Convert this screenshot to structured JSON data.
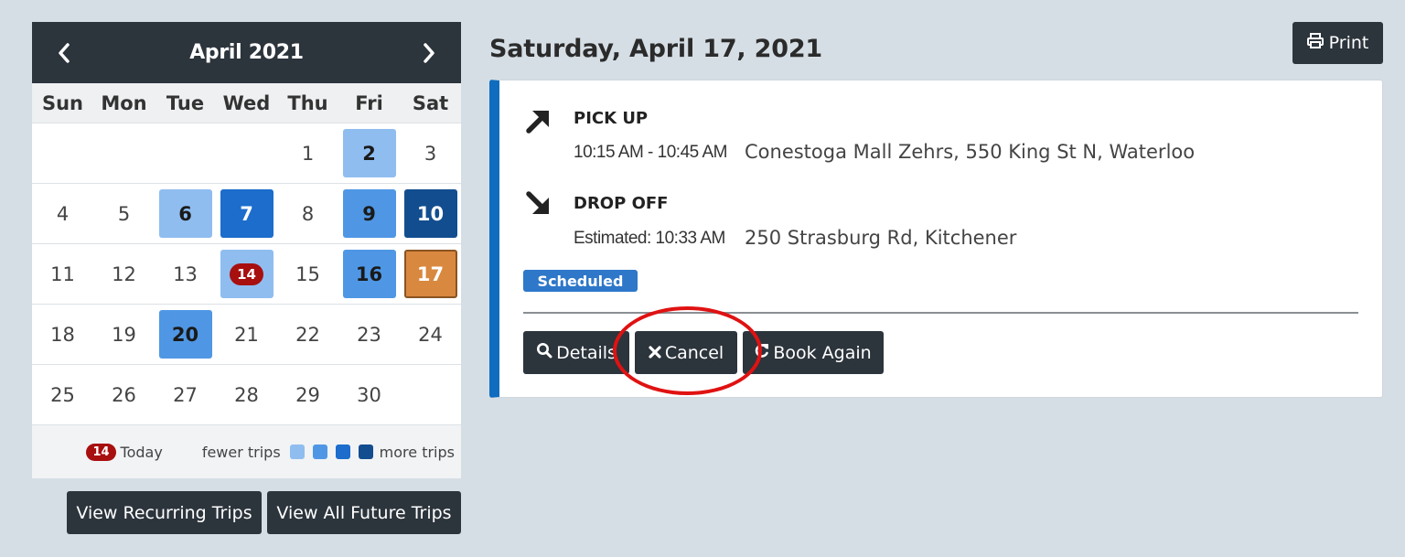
{
  "calendar": {
    "title": "April 2021",
    "prev_icon": "chevron-left-icon",
    "next_icon": "chevron-right-icon",
    "weekdays": [
      "Sun",
      "Mon",
      "Tue",
      "Wed",
      "Thu",
      "Fri",
      "Sat"
    ],
    "weeks": [
      [
        "",
        "",
        "",
        "",
        "1",
        "2",
        "3"
      ],
      [
        "4",
        "5",
        "6",
        "7",
        "8",
        "9",
        "10"
      ],
      [
        "11",
        "12",
        "13",
        "14",
        "15",
        "16",
        "17"
      ],
      [
        "18",
        "19",
        "20",
        "21",
        "22",
        "23",
        "24"
      ],
      [
        "25",
        "26",
        "27",
        "28",
        "29",
        "30",
        ""
      ]
    ],
    "trip_levels": {
      "2": 1,
      "6": 1,
      "7": 3,
      "9": 2,
      "10": 4,
      "14": 1,
      "16": 2,
      "20": 2
    },
    "today": "14",
    "selected": "17",
    "level_colors": [
      "#8fbdf0",
      "#4f97e5",
      "#1c6dcc",
      "#124d8f"
    ],
    "selected_color": "#d9883f",
    "today_color": "#a80f0f"
  },
  "legend": {
    "today_badge": "14",
    "today_label": "Today",
    "fewer_label": "fewer trips",
    "more_label": "more trips"
  },
  "calendar_buttons": {
    "recurring": "View Recurring Trips",
    "future": "View All Future Trips"
  },
  "header": {
    "date": "Saturday, April 17, 2021",
    "print_label": "Print",
    "print_icon": "printer-icon"
  },
  "trip": {
    "pickup": {
      "label": "PICK UP",
      "time": "10:15 AM - 10:45 AM",
      "address": "Conestoga Mall Zehrs, 550 King St N, Waterloo",
      "icon": "arrow-up-right-icon"
    },
    "dropoff": {
      "label": "DROP OFF",
      "time": "Estimated: 10:33 AM",
      "address": "250 Strasburg Rd, Kitchener",
      "icon": "arrow-down-right-icon"
    },
    "status": "Scheduled",
    "accent_color": "#0f6cbf"
  },
  "actions": {
    "details": "Details",
    "cancel": "Cancel",
    "book_again": "Book Again"
  }
}
